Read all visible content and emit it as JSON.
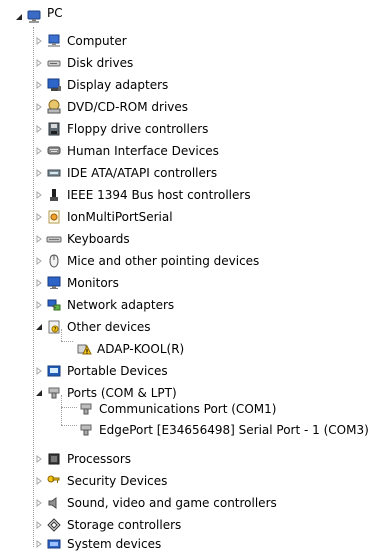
{
  "colors": {
    "text": "#000000",
    "background": "#ffffff",
    "tree_line": "#a0a0a0",
    "twisty_collapsed": "#a7a7a7",
    "twisty_expanded": "#262626",
    "monitor_blue": "#2d64c8",
    "warning_yellow": "#f4c51a"
  },
  "tree": {
    "root": {
      "label": "PC",
      "icon": "computer-icon"
    },
    "nodes": [
      {
        "label": "Computer",
        "icon": "computer-icon",
        "state": "collapsed"
      },
      {
        "label": "Disk drives",
        "icon": "disk-drive-icon",
        "state": "collapsed"
      },
      {
        "label": "Display adapters",
        "icon": "display-adapter-icon",
        "state": "collapsed"
      },
      {
        "label": "DVD/CD-ROM drives",
        "icon": "dvd-drive-icon",
        "state": "collapsed"
      },
      {
        "label": "Floppy drive controllers",
        "icon": "floppy-controller-icon",
        "state": "collapsed"
      },
      {
        "label": "Human Interface Devices",
        "icon": "hid-icon",
        "state": "collapsed"
      },
      {
        "label": "IDE ATA/ATAPI controllers",
        "icon": "ide-controller-icon",
        "state": "collapsed"
      },
      {
        "label": "IEEE 1394 Bus host controllers",
        "icon": "ieee1394-icon",
        "state": "collapsed"
      },
      {
        "label": "IonMultiPortSerial",
        "icon": "serial-driver-icon",
        "state": "collapsed"
      },
      {
        "label": "Keyboards",
        "icon": "keyboard-icon",
        "state": "collapsed"
      },
      {
        "label": "Mice and other pointing devices",
        "icon": "mouse-icon",
        "state": "collapsed"
      },
      {
        "label": "Monitors",
        "icon": "monitor-icon",
        "state": "collapsed"
      },
      {
        "label": "Network adapters",
        "icon": "network-adapter-icon",
        "state": "collapsed"
      },
      {
        "label": "Other devices",
        "icon": "unknown-device-icon",
        "state": "expanded"
      },
      {
        "label": "ADAP-KOOL(R)",
        "icon": "warning-device-icon",
        "state": "child"
      },
      {
        "label": "Portable Devices",
        "icon": "portable-device-icon",
        "state": "collapsed"
      },
      {
        "label": "Ports (COM & LPT)",
        "icon": "port-icon",
        "state": "expanded"
      },
      {
        "label": "Communications Port (COM1)",
        "icon": "com-port-icon",
        "state": "child"
      },
      {
        "label": "EdgePort [E34656498] Serial Port - 1 (COM3)",
        "icon": "com-port-icon",
        "state": "child"
      },
      {
        "label": "Processors",
        "icon": "processor-icon",
        "state": "collapsed"
      },
      {
        "label": "Security Devices",
        "icon": "security-device-icon",
        "state": "collapsed"
      },
      {
        "label": "Sound, video and game controllers",
        "icon": "sound-icon",
        "state": "collapsed"
      },
      {
        "label": "Storage controllers",
        "icon": "storage-controller-icon",
        "state": "collapsed"
      },
      {
        "label": "System devices",
        "icon": "system-device-icon",
        "state": "collapsed"
      }
    ]
  }
}
